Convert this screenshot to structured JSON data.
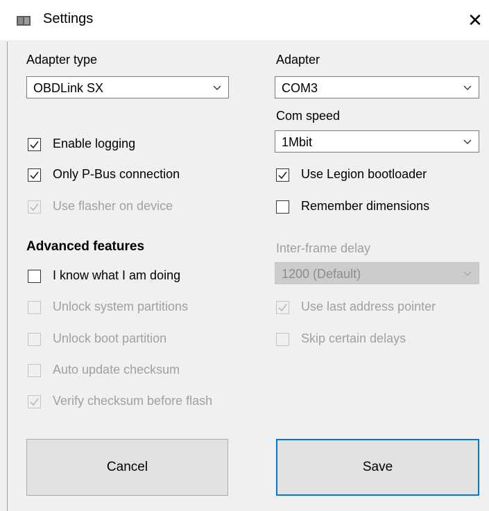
{
  "window": {
    "title": "Settings",
    "icon": "app-icon",
    "close_glyph": "✕"
  },
  "adapter_type": {
    "label": "Adapter type",
    "value": "OBDLink SX"
  },
  "adapter": {
    "label": "Adapter",
    "value": "COM3"
  },
  "com_speed": {
    "label": "Com speed",
    "value": "1Mbit"
  },
  "checkboxes_left": [
    {
      "label": "Enable logging",
      "checked": true,
      "enabled": true
    },
    {
      "label": "Only P-Bus connection",
      "checked": true,
      "enabled": true
    },
    {
      "label": "Use flasher on device",
      "checked": true,
      "enabled": false
    }
  ],
  "checkboxes_right": [
    {
      "label": "Use Legion bootloader",
      "checked": true,
      "enabled": true
    },
    {
      "label": "Remember dimensions",
      "checked": false,
      "enabled": true
    }
  ],
  "advanced": {
    "heading": "Advanced features",
    "items": [
      {
        "label": "I know what I am doing",
        "checked": false,
        "enabled": true
      },
      {
        "label": "Unlock system partitions",
        "checked": false,
        "enabled": false
      },
      {
        "label": "Unlock boot partition",
        "checked": false,
        "enabled": false
      },
      {
        "label": "Auto update checksum",
        "checked": false,
        "enabled": false
      },
      {
        "label": "Verify checksum before flash",
        "checked": true,
        "enabled": false
      }
    ]
  },
  "inter_frame": {
    "label": "Inter-frame delay",
    "value": "1200 (Default)",
    "items": [
      {
        "label": "Use last address pointer",
        "checked": true,
        "enabled": false
      },
      {
        "label": "Skip certain delays",
        "checked": false,
        "enabled": false
      }
    ]
  },
  "buttons": {
    "cancel": "Cancel",
    "save": "Save"
  },
  "colors": {
    "accent": "#0078d7",
    "disabled_text": "#a0a0a0",
    "window_bg": "#f0f0f0"
  }
}
